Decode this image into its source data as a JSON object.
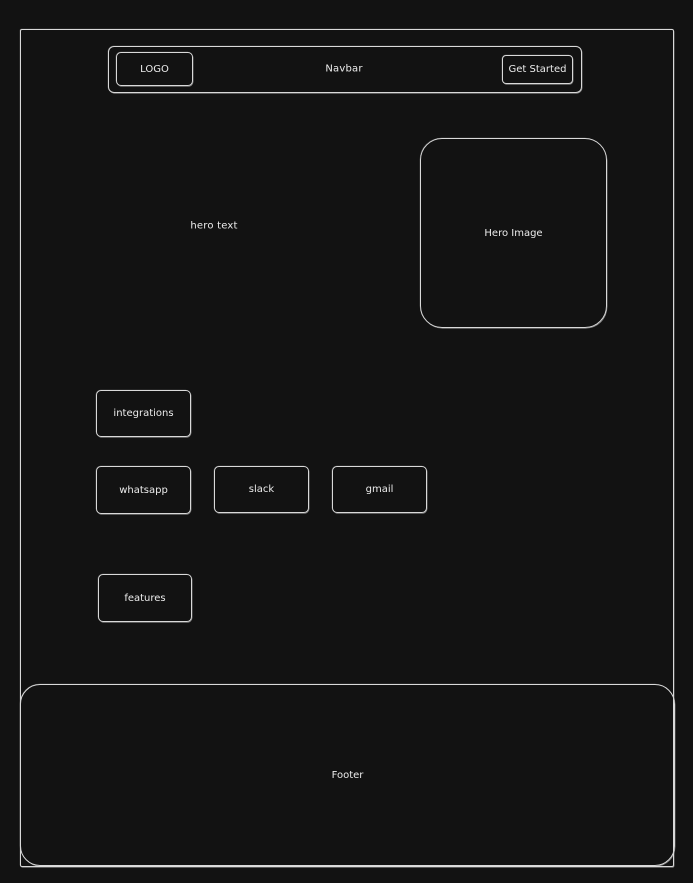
{
  "frame": {
    "navbar": {
      "logo_label": "LOGO",
      "title_label": "Navbar",
      "cta_label": "Get Started"
    },
    "hero": {
      "text_label": "hero text",
      "image_label": "Hero Image"
    },
    "integrations": {
      "heading_label": "integrations",
      "items": [
        {
          "label": "whatsapp"
        },
        {
          "label": "slack"
        },
        {
          "label": "gmail"
        }
      ]
    },
    "features": {
      "label": "features"
    },
    "footer": {
      "label": "Footer"
    }
  },
  "colors": {
    "background": "#121212",
    "stroke": "#d9d9d9",
    "text": "#ececec"
  }
}
